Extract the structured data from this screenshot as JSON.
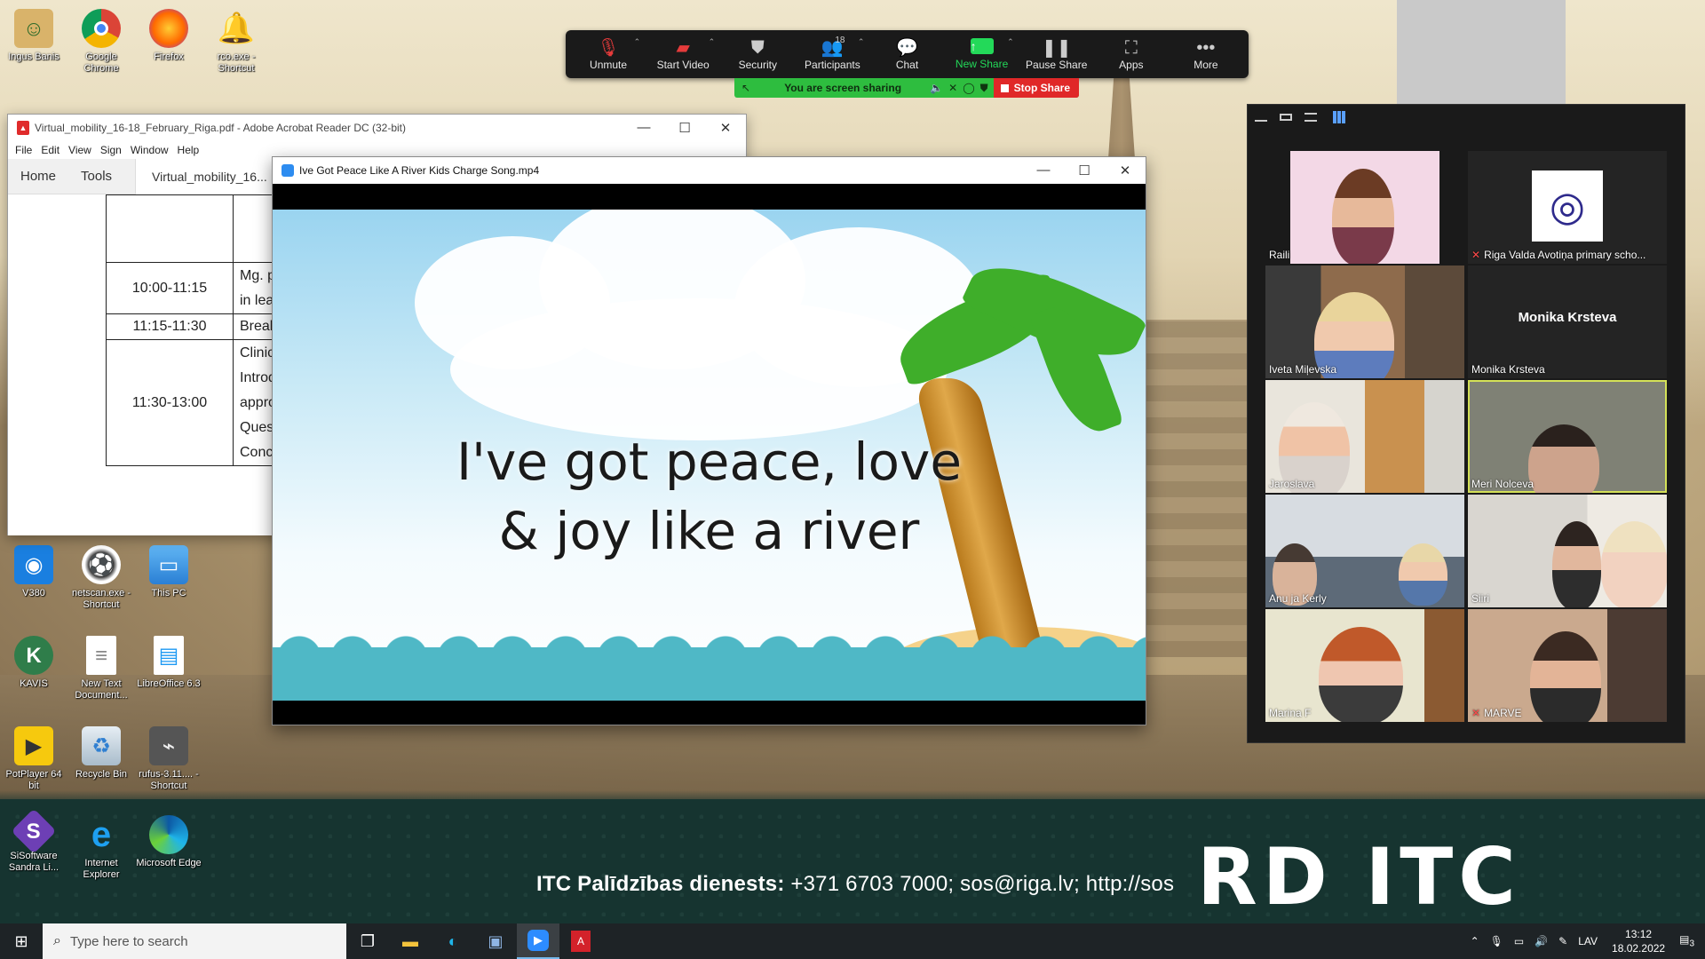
{
  "desktop": {
    "icons": [
      {
        "label": "Ingus Banis",
        "glyph": "person-icon"
      },
      {
        "label": "Google Chrome",
        "glyph": "chrome-icon"
      },
      {
        "label": "Firefox",
        "glyph": "firefox-icon"
      },
      {
        "label": "rco.exe - Shortcut",
        "glyph": "bell-icon"
      },
      {
        "label": "V380",
        "glyph": "camera-icon"
      },
      {
        "label": "netscan.exe - Shortcut",
        "glyph": "ball-icon"
      },
      {
        "label": "This PC",
        "glyph": "computer-icon"
      },
      {
        "label": "KAVIS",
        "glyph": "kavis-icon"
      },
      {
        "label": "New Text Document...",
        "glyph": "text-file-icon"
      },
      {
        "label": "LibreOffice 6.3",
        "glyph": "libreoffice-icon"
      },
      {
        "label": "PotPlayer 64 bit",
        "glyph": "potplayer-icon"
      },
      {
        "label": "Recycle Bin",
        "glyph": "recycle-bin-icon"
      },
      {
        "label": "rufus-3.11.... - Shortcut",
        "glyph": "usb-icon"
      },
      {
        "label": "SiSoftware Sandra Li...",
        "glyph": "sandra-icon"
      },
      {
        "label": "Internet Explorer",
        "glyph": "ie-icon"
      },
      {
        "label": "Microsoft Edge",
        "glyph": "edge-icon"
      }
    ],
    "helpdesk_bold": "ITC Palīdzības dienests:",
    "helpdesk_rest": "+371 6703 7000; sos@riga.lv; http://sos",
    "logo": "RD ITC"
  },
  "zoom": {
    "toolbar": {
      "unmute": "Unmute",
      "start_video": "Start Video",
      "security": "Security",
      "participants": "Participants",
      "participants_count": "18",
      "chat": "Chat",
      "new_share": "New Share",
      "pause_share": "Pause Share",
      "apps": "Apps",
      "more": "More"
    },
    "share_status": "You are screen sharing",
    "stop_share": "Stop Share"
  },
  "acrobat": {
    "title": "Virtual_mobility_16-18_February_Riga.pdf - Adobe Acrobat Reader DC (32-bit)",
    "menu": [
      "File",
      "Edit",
      "View",
      "Sign",
      "Window",
      "Help"
    ],
    "tabs": {
      "home": "Home",
      "tools": "Tools",
      "doc": "Virtual_mobility_16..."
    },
    "schedule": [
      {
        "time": "",
        "lines": [
          ""
        ]
      },
      {
        "time": "10:00-11:15",
        "lines": [
          "Mg. p",
          "in lea"
        ]
      },
      {
        "time": "11:15-11:30",
        "lines": [
          "Break"
        ]
      },
      {
        "time": "11:30-13:00",
        "lines": [
          "Clinic",
          "Introd",
          "appro",
          "Ques",
          "Conc"
        ]
      }
    ]
  },
  "video": {
    "title": "Ive Got Peace Like A River Kids Charge Song.mp4",
    "line1": "I've got peace, love",
    "line2": "& joy like a river"
  },
  "gallery": {
    "tiles": [
      {
        "name": "Raili",
        "muted": false
      },
      {
        "name": "Riga Valda Avotiņa primary scho...",
        "muted": true
      },
      {
        "name": "Iveta Miļevska",
        "muted": false
      },
      {
        "name": "Monika Krsteva",
        "muted": false,
        "display": "Monika Krsteva"
      },
      {
        "name": "Jaroslava",
        "muted": false
      },
      {
        "name": "Meri Nolceva",
        "muted": false
      },
      {
        "name": "Anu ja Kerly",
        "muted": false
      },
      {
        "name": "Siiri",
        "muted": false
      },
      {
        "name": "Marina F",
        "muted": false
      },
      {
        "name": "MARVE",
        "muted": true
      }
    ]
  },
  "taskbar": {
    "search_placeholder": "Type here to search",
    "language": "LAV",
    "time": "13:12",
    "date": "18.02.2022",
    "notifications": "3"
  }
}
